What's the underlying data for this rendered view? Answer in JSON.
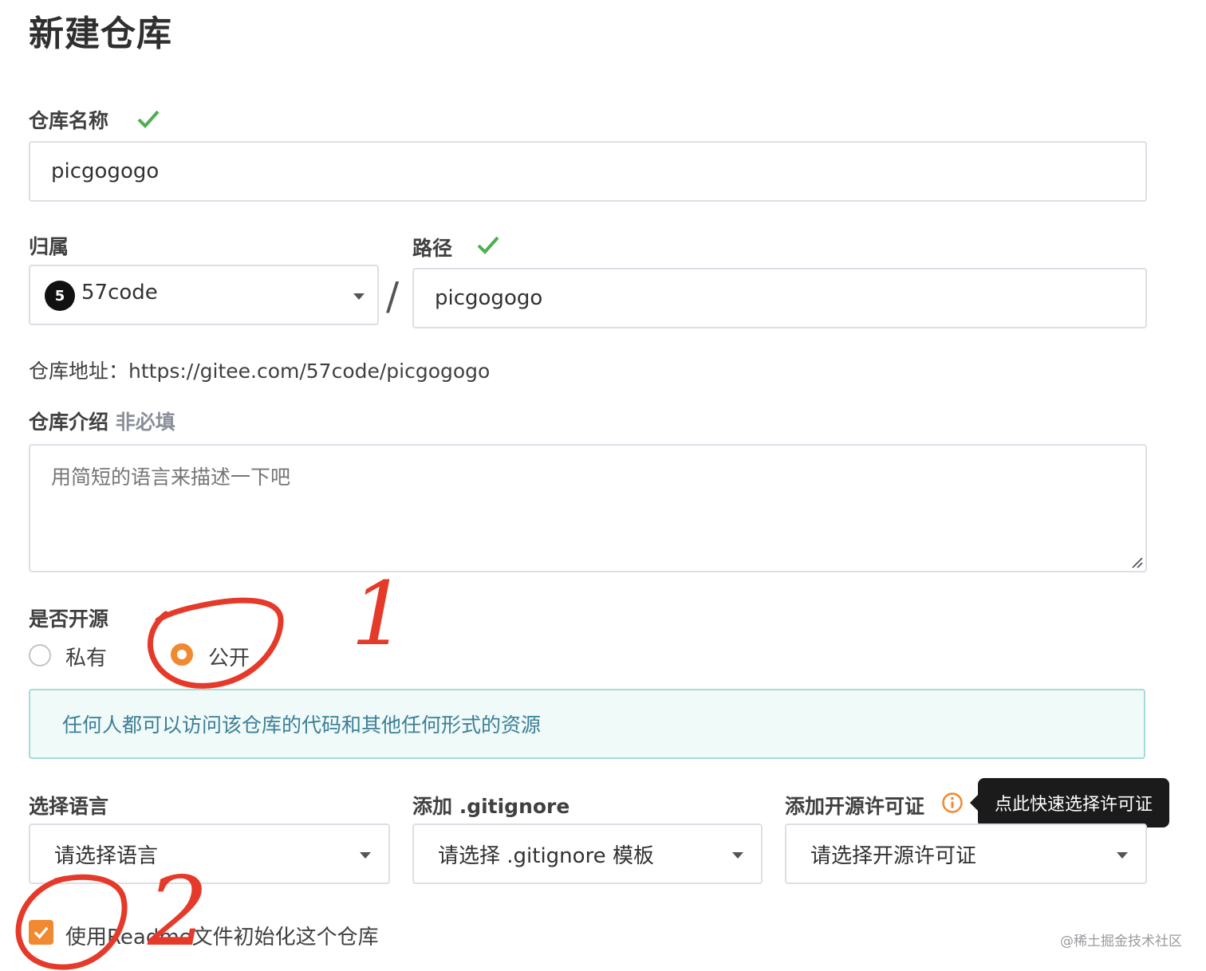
{
  "page": {
    "title": "新建仓库"
  },
  "repo_name": {
    "label": "仓库名称",
    "value": "picgogogo"
  },
  "owner": {
    "label": "归属",
    "avatar_letter": "5",
    "value": "57code"
  },
  "separator": "/",
  "path": {
    "label": "路径",
    "value": "picgogogo"
  },
  "repo_url": {
    "prefix": "仓库地址：",
    "url": "https://gitee.com/57code/picgogogo"
  },
  "intro": {
    "label": "仓库介绍",
    "optional": "非必填",
    "placeholder": "用简短的语言来描述一下吧"
  },
  "visibility": {
    "label": "是否开源",
    "private_label": "私有",
    "public_label": "公开",
    "selected": "public",
    "notice": "任何人都可以访问该仓库的代码和其他任何形式的资源"
  },
  "language": {
    "label": "选择语言",
    "placeholder": "请选择语言"
  },
  "gitignore": {
    "label": "添加 .gitignore",
    "placeholder": "请选择 .gitignore 模板"
  },
  "license": {
    "label": "添加开源许可证",
    "placeholder": "请选择开源许可证",
    "tooltip": "点此快速选择许可证"
  },
  "readme": {
    "label": "使用Readme文件初始化这个仓库",
    "checked": true
  },
  "watermark": "@稀土掘金技术社区",
  "annotations": {
    "mark_1": "1",
    "mark_2": "2"
  },
  "colors": {
    "accent": "#f0892f",
    "success": "#4caf50",
    "annotation": "#e53a2a",
    "notice_bg": "#effaf9",
    "notice_text": "#3c7f96"
  },
  "icons": [
    "check-icon",
    "chevron-down-icon",
    "info-icon",
    "checkbox-check-icon",
    "resize-handle-icon"
  ]
}
